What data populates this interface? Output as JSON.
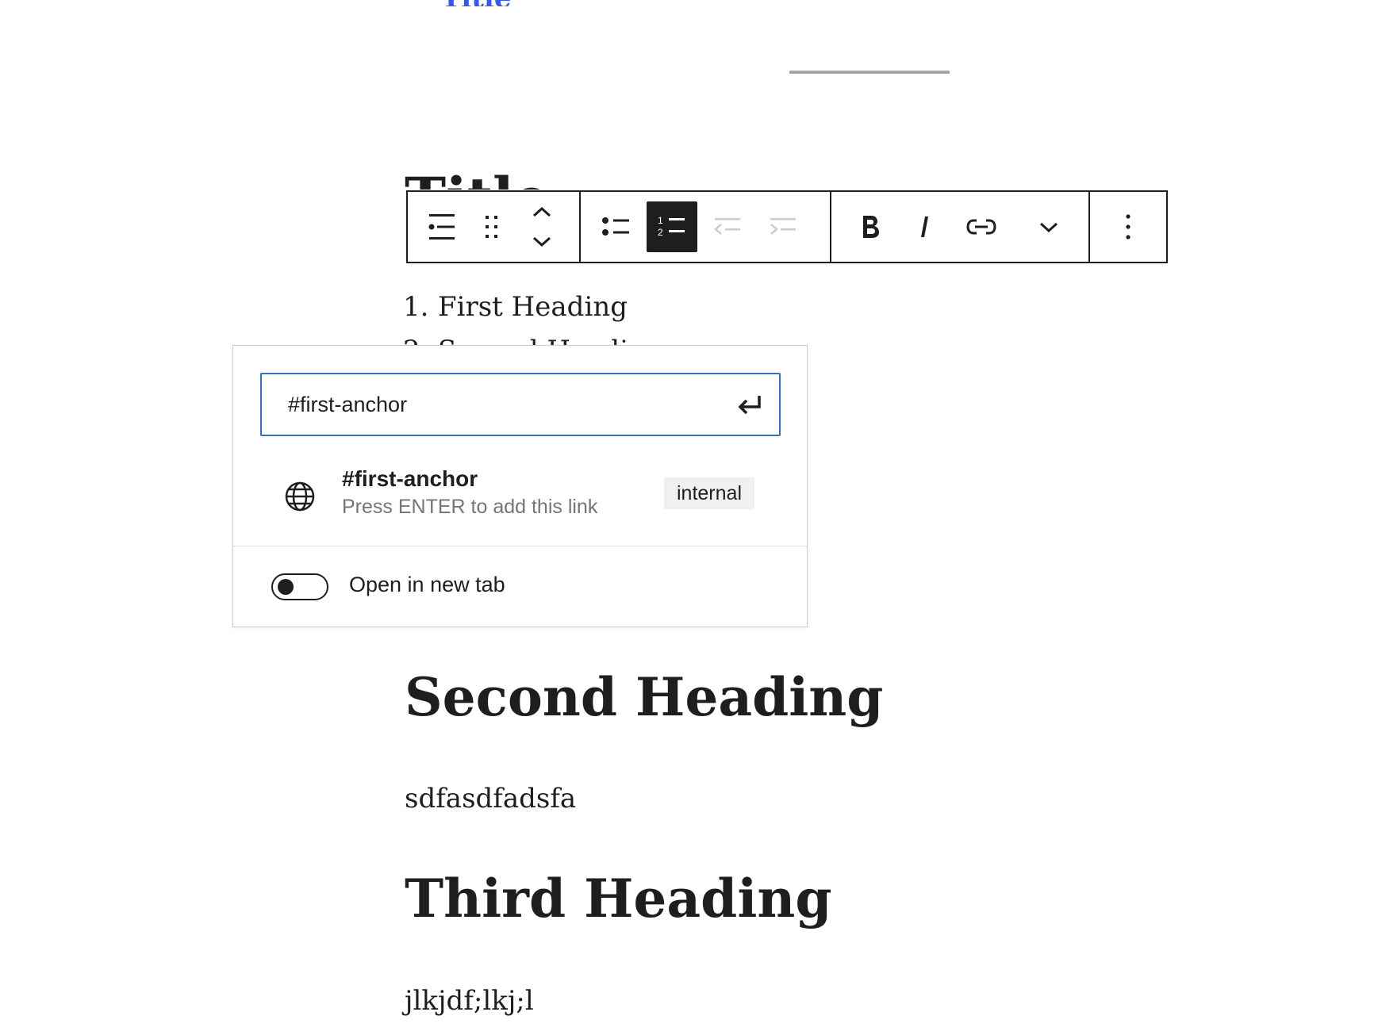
{
  "document": {
    "top_link_text": "Title",
    "title": "Title",
    "list": [
      {
        "number": "1.",
        "text": "First Heading"
      },
      {
        "number": "2.",
        "text": "Second Heading"
      }
    ],
    "headings": {
      "second": "Second Heading",
      "third": "Third Heading"
    },
    "paragraphs": {
      "after_second": "sdfasdfadsfa",
      "after_third": "jlkjdf;lkj;l"
    }
  },
  "toolbar": {
    "buttons": [
      {
        "name": "block-type-list",
        "icon": "list-block-icon"
      },
      {
        "name": "drag-handle",
        "icon": "drag-handle-icon"
      },
      {
        "name": "move-up-down",
        "icon": "chevron-up-down-icon"
      },
      {
        "name": "unordered-list",
        "icon": "bullet-list-icon"
      },
      {
        "name": "ordered-list",
        "icon": "numbered-list-icon",
        "active": true
      },
      {
        "name": "outdent",
        "icon": "outdent-icon",
        "disabled": true
      },
      {
        "name": "indent",
        "icon": "indent-icon",
        "disabled": true
      },
      {
        "name": "bold",
        "icon": "bold-icon"
      },
      {
        "name": "italic",
        "icon": "italic-icon"
      },
      {
        "name": "link",
        "icon": "link-icon"
      },
      {
        "name": "more-rich-text",
        "icon": "chevron-down-icon"
      },
      {
        "name": "options",
        "icon": "more-vertical-icon"
      }
    ],
    "ordered_list_icon_digits": [
      "1",
      "2"
    ]
  },
  "link_popover": {
    "input_value": "#first-anchor",
    "suggestion": {
      "title": "#first-anchor",
      "subtitle": "Press ENTER to add this link",
      "badge": "internal",
      "icon": "globe-icon"
    },
    "open_in_new_tab": {
      "label": "Open in new tab",
      "checked": false
    }
  },
  "colors": {
    "text": "#1e1e1e",
    "input_border": "#3872b8",
    "muted": "#757575",
    "badge_bg": "#f0f0f0",
    "separator": "#a7a7a7"
  }
}
